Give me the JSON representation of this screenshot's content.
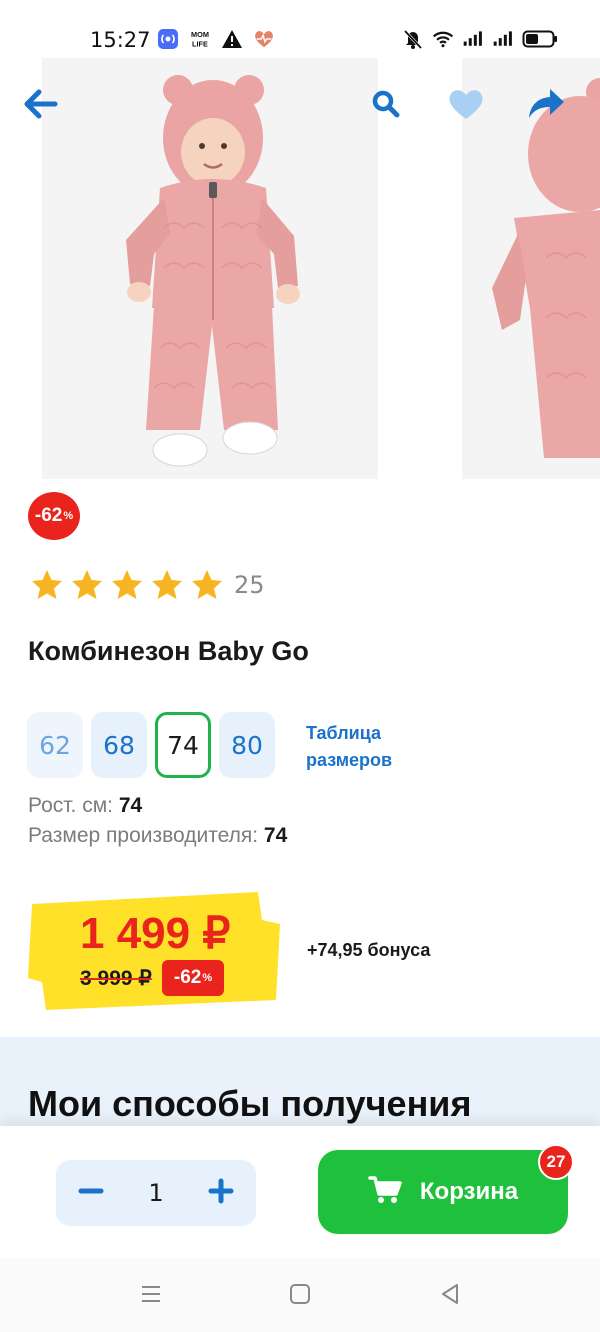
{
  "status_bar": {
    "time": "15:27",
    "left_icons": [
      "nfc-icon",
      "mom-life-icon",
      "warning-icon",
      "heart-health-icon"
    ],
    "mom_life_text": "MOM LIFE",
    "right_icons": [
      "mute-icon",
      "wifi-icon",
      "signal-icon",
      "signal-icon",
      "battery-icon"
    ]
  },
  "header": {
    "icons": [
      "back-arrow-icon",
      "search-icon",
      "heart-icon",
      "share-icon"
    ]
  },
  "product": {
    "discount_badge": "-62",
    "discount_unit": "%",
    "rating_stars": 5,
    "rating_count": "25",
    "title": "Комбинезон Baby Go",
    "sizes": [
      "62",
      "68",
      "74",
      "80"
    ],
    "selected_size": "74",
    "size_table_label_line1": "Таблица",
    "size_table_label_line2": "размеров",
    "height_label": "Рост. см:",
    "height_value": "74",
    "manufacturer_size_label": "Размер производителя:",
    "manufacturer_size_value": "74"
  },
  "price": {
    "current": "1 499 ₽",
    "old": "3 999 ₽",
    "discount": "-62",
    "discount_unit": "%",
    "bonus": "+74,95 бонуса"
  },
  "delivery": {
    "title": "Мои способы получения"
  },
  "cart": {
    "quantity": "1",
    "button_label": "Корзина",
    "badge_count": "27"
  },
  "colors": {
    "brand_blue": "#1a73c9",
    "accent_green": "#1fc13c",
    "price_red": "#e8241c",
    "price_yellow": "#ffe12a",
    "star_yellow": "#f7b524"
  }
}
